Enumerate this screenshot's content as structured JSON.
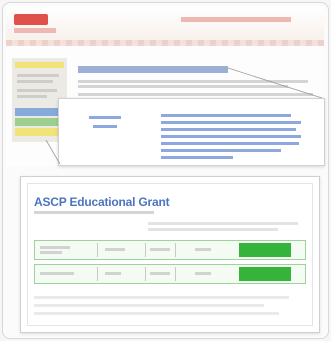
{
  "document": {
    "title": "ASCP Educational Grant"
  },
  "colors": {
    "brand_red": "#d9342b",
    "link_blue": "#2b5cb4",
    "status_green": "#36b33a",
    "sidebar_yellow": "#f2e27a",
    "sidebar_blue": "#5b8fd6",
    "sidebar_green": "#7cc36a"
  }
}
